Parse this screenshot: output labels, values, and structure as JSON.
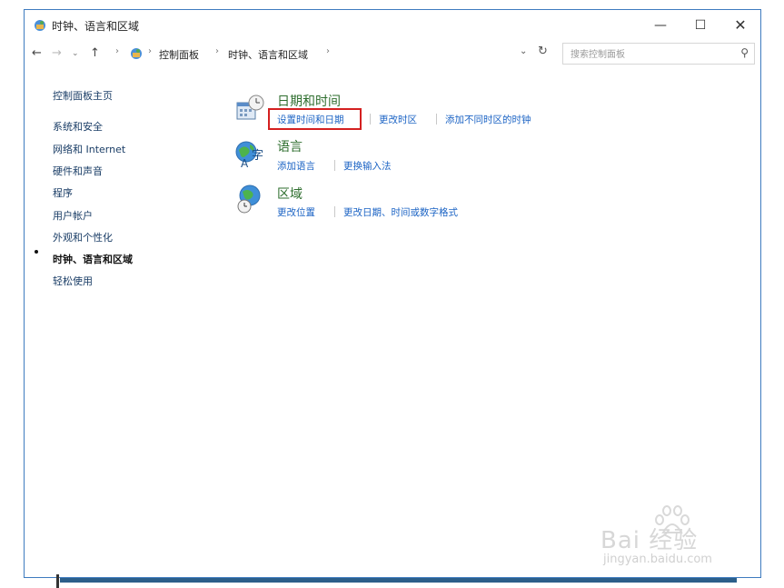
{
  "window": {
    "title": "时钟、语言和区域",
    "controls": {
      "minimize": "—",
      "maximize": "☐",
      "close": "✕"
    }
  },
  "addressbar": {
    "back": "←",
    "forward": "→",
    "recent": "⌄",
    "up": "↑",
    "breadcrumbs": [
      "控制面板",
      "时钟、语言和区域"
    ],
    "separator": "›",
    "dropdown": "⌄",
    "refresh": "↻",
    "search_placeholder": "搜索控制面板",
    "search_glyph": "⚲"
  },
  "sidebar": {
    "home": "控制面板主页",
    "items": [
      "系统和安全",
      "网络和 Internet",
      "硬件和声音",
      "程序",
      "用户帐户",
      "外观和个性化",
      "时钟、语言和区域",
      "轻松使用"
    ],
    "active_index": 6
  },
  "categories": [
    {
      "title": "日期和时间",
      "icon": "calendar-clock-icon",
      "links": [
        "设置时间和日期",
        "更改时区",
        "添加不同时区的时钟"
      ]
    },
    {
      "title": "语言",
      "icon": "language-globe-icon",
      "links": [
        "添加语言",
        "更换输入法"
      ]
    },
    {
      "title": "区域",
      "icon": "region-globe-clock-icon",
      "links": [
        "更改位置",
        "更改日期、时间或数字格式"
      ]
    }
  ],
  "watermark": {
    "logo": "Bai 经验",
    "url": "jingyan.baidu.com"
  },
  "colors": {
    "link": "#1b63c4",
    "category_title": "#2e6e2e",
    "highlight": "#d42020",
    "border": "#3e7bbf"
  }
}
